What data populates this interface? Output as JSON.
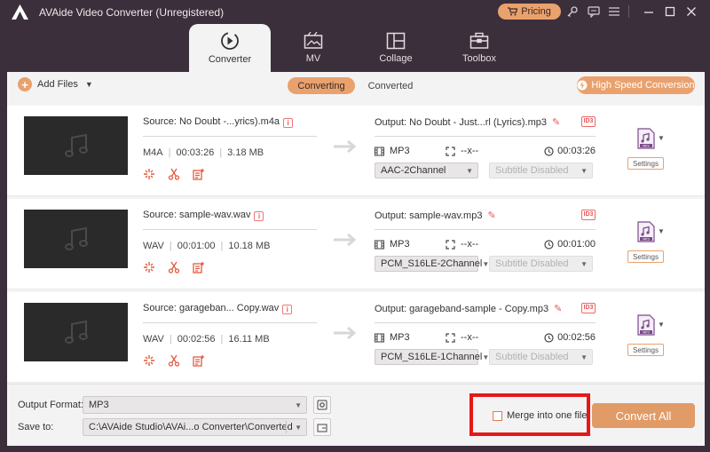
{
  "window": {
    "title": "AVAide Video Converter (Unregistered)",
    "pricing_label": "Pricing",
    "accent_color": "#e9a16d"
  },
  "nav": {
    "tabs": [
      {
        "label": "Converter",
        "icon": "converter-icon",
        "active": true
      },
      {
        "label": "MV",
        "icon": "mv-icon",
        "active": false
      },
      {
        "label": "Collage",
        "icon": "collage-icon",
        "active": false
      },
      {
        "label": "Toolbox",
        "icon": "toolbox-icon",
        "active": false
      }
    ]
  },
  "toolbar": {
    "add_files_label": "Add Files",
    "converting_label": "Converting",
    "converted_label": "Converted",
    "high_speed_label": "High Speed Conversion"
  },
  "files": [
    {
      "source": "Source: No Doubt -...yrics).m4a",
      "format": "M4A",
      "duration": "00:03:26",
      "size": "3.18 MB",
      "output": "Output: No Doubt - Just...rl (Lyrics).mp3",
      "out_format": "MP3",
      "resolution": "--x--",
      "out_duration": "00:03:26",
      "audio_channel": "AAC-2Channel",
      "subtitle": "Subtitle Disabled",
      "settings_label": "Settings"
    },
    {
      "source": "Source: sample-wav.wav",
      "format": "WAV",
      "duration": "00:01:00",
      "size": "10.18 MB",
      "output": "Output: sample-wav.mp3",
      "out_format": "MP3",
      "resolution": "--x--",
      "out_duration": "00:01:00",
      "audio_channel": "PCM_S16LE-2Channel",
      "subtitle": "Subtitle Disabled",
      "settings_label": "Settings"
    },
    {
      "source": "Source: garageban... Copy.wav",
      "format": "WAV",
      "duration": "00:02:56",
      "size": "16.11 MB",
      "output": "Output: garageband-sample - Copy.mp3",
      "out_format": "MP3",
      "resolution": "--x--",
      "out_duration": "00:02:56",
      "audio_channel": "PCM_S16LE-1Channel",
      "subtitle": "Subtitle Disabled",
      "settings_label": "Settings"
    }
  ],
  "bottom": {
    "output_format_label": "Output Format:",
    "output_format_value": "MP3",
    "save_to_label": "Save to:",
    "save_to_value": "C:\\AVAide Studio\\AVAi...o Converter\\Converted",
    "merge_label": "Merge into one file",
    "convert_all_label": "Convert All"
  }
}
